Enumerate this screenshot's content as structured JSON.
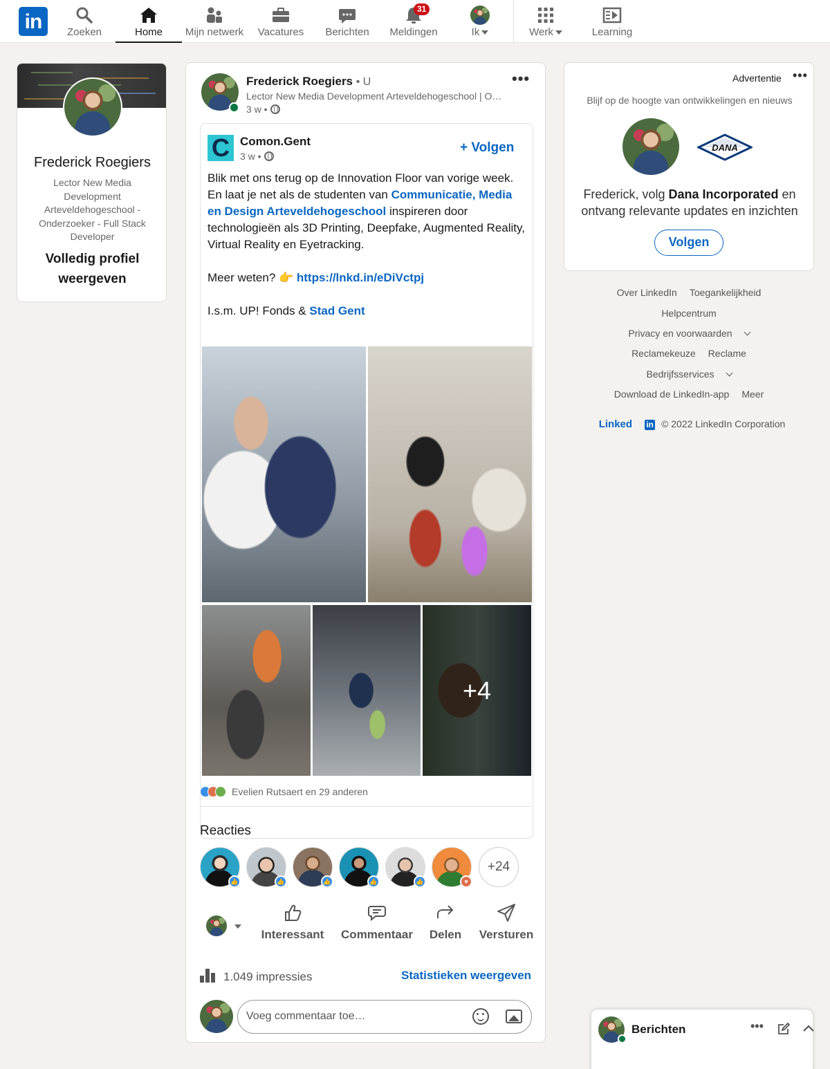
{
  "nav": {
    "logo": "in",
    "items": [
      {
        "label": "Zoeken",
        "icon": "search-icon"
      },
      {
        "label": "Home",
        "icon": "home-icon"
      },
      {
        "label": "Mijn netwerk",
        "icon": "network-icon"
      },
      {
        "label": "Vacatures",
        "icon": "briefcase-icon"
      },
      {
        "label": "Berichten",
        "icon": "messaging-icon"
      },
      {
        "label": "Meldingen",
        "icon": "bell-icon",
        "badge": "31"
      },
      {
        "label": "Ik",
        "icon": "avatar"
      },
      {
        "label": "Werk",
        "icon": "grid-icon"
      },
      {
        "label": "Learning",
        "icon": "learning-icon"
      }
    ]
  },
  "profile": {
    "name": "Frederick Roegiers",
    "headline": "Lector New Media Development Arteveldehogeschool - Onderzoeker - Full Stack Developer",
    "view_full": "Volledig profiel weergeven"
  },
  "post": {
    "author": "Frederick Roegiers",
    "degree": "• U",
    "headline": "Lector New Media Development Arteveldehogeschool | Onderzoeker",
    "time": "3 w •",
    "shared": {
      "org": "Comon.Gent",
      "time": "3 w •",
      "follow": "+ Volgen",
      "p1_a": "Blik met ons terug op de Innovation Floor van vorige week. En laat je net als de studenten van ",
      "p1_link": "Communicatie, Media en Design Arteveldehogeschool",
      "p1_b": " inspireren door technologieën als 3D Printing, Deepfake, Augmented Reality, Virtual Reality en Eyetracking.",
      "p2_a": "Meer weten? 👉 ",
      "p2_link": "https://lnkd.in/eDiVctpj",
      "p3_a": "I.s.m. UP! Fonds & ",
      "p3_link": "Stad Gent",
      "more_images": "+4"
    },
    "reactions_text": "Evelien Rutsaert en 29 anderen",
    "reacties_title": "Reacties",
    "more_reactors": "+24",
    "actions": [
      {
        "label": "Interessant",
        "icon": "like-icon"
      },
      {
        "label": "Commentaar",
        "icon": "comment-icon"
      },
      {
        "label": "Delen",
        "icon": "share-icon"
      },
      {
        "label": "Versturen",
        "icon": "send-icon"
      }
    ],
    "impressions": "1.049 impressies",
    "stats_link": "Statistieken weergeven",
    "comment_placeholder": "Voeg commentaar toe…"
  },
  "ad": {
    "label": "Advertentie",
    "subtitle": "Blijf op de hoogte van ontwikkelingen en nieuws",
    "logo_text": "DANA",
    "text_a": "Frederick, volg ",
    "text_b": "Dana Incorporated",
    "text_c": " en ontvang relevante updates en inzichten",
    "button": "Volgen"
  },
  "footer": {
    "row1": [
      "Over LinkedIn",
      "Toegankelijkheid"
    ],
    "row2": [
      "Helpcentrum"
    ],
    "row3": "Privacy en voorwaarden",
    "row4": [
      "Reclamekeuze",
      "Reclame"
    ],
    "row5": "Bedrijfsservices",
    "row6": [
      "Download de LinkedIn-app",
      "Meer"
    ],
    "brand": "Linked",
    "brand_in": "in",
    "copyright": "© 2022 LinkedIn Corporation"
  },
  "messaging": {
    "title": "Berichten"
  },
  "colors": {
    "brand": "#0a66c2",
    "badge": "#cc1016",
    "online": "#057642"
  }
}
